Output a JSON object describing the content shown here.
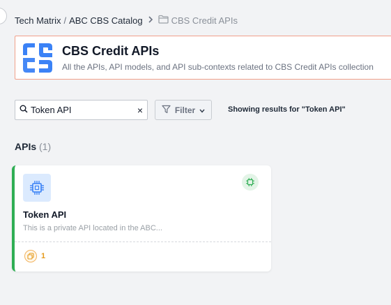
{
  "breadcrumb": {
    "items": [
      "Tech Matrix",
      "ABC CBS Catalog"
    ],
    "separator": "/",
    "current": "CBS Credit APIs",
    "current_icon": "folder-icon"
  },
  "header": {
    "title": "CBS Credit APIs",
    "description": "All the APIs, API models, and API sub-contexts related to CBS Credit APIs collection",
    "logo": "api-context-logo",
    "accent_color": "#3b82f6",
    "border_color": "#f0a08a"
  },
  "search": {
    "value": "Token API",
    "icon": "search-icon",
    "clear_icon": "close-icon"
  },
  "filter": {
    "label": "Filter",
    "icon": "filter-icon"
  },
  "results": {
    "text": "Showing results for \"Token API\""
  },
  "section": {
    "title": "APIs",
    "count": "(1)"
  },
  "cards": [
    {
      "title": "Token API",
      "description": "This is a private API located in the ABC...",
      "icon": "chip-icon",
      "badge_icon": "chip-badge-icon",
      "footer_count": "1",
      "footer_icon": "copy-icon",
      "status_color": "#2fae54"
    }
  ]
}
